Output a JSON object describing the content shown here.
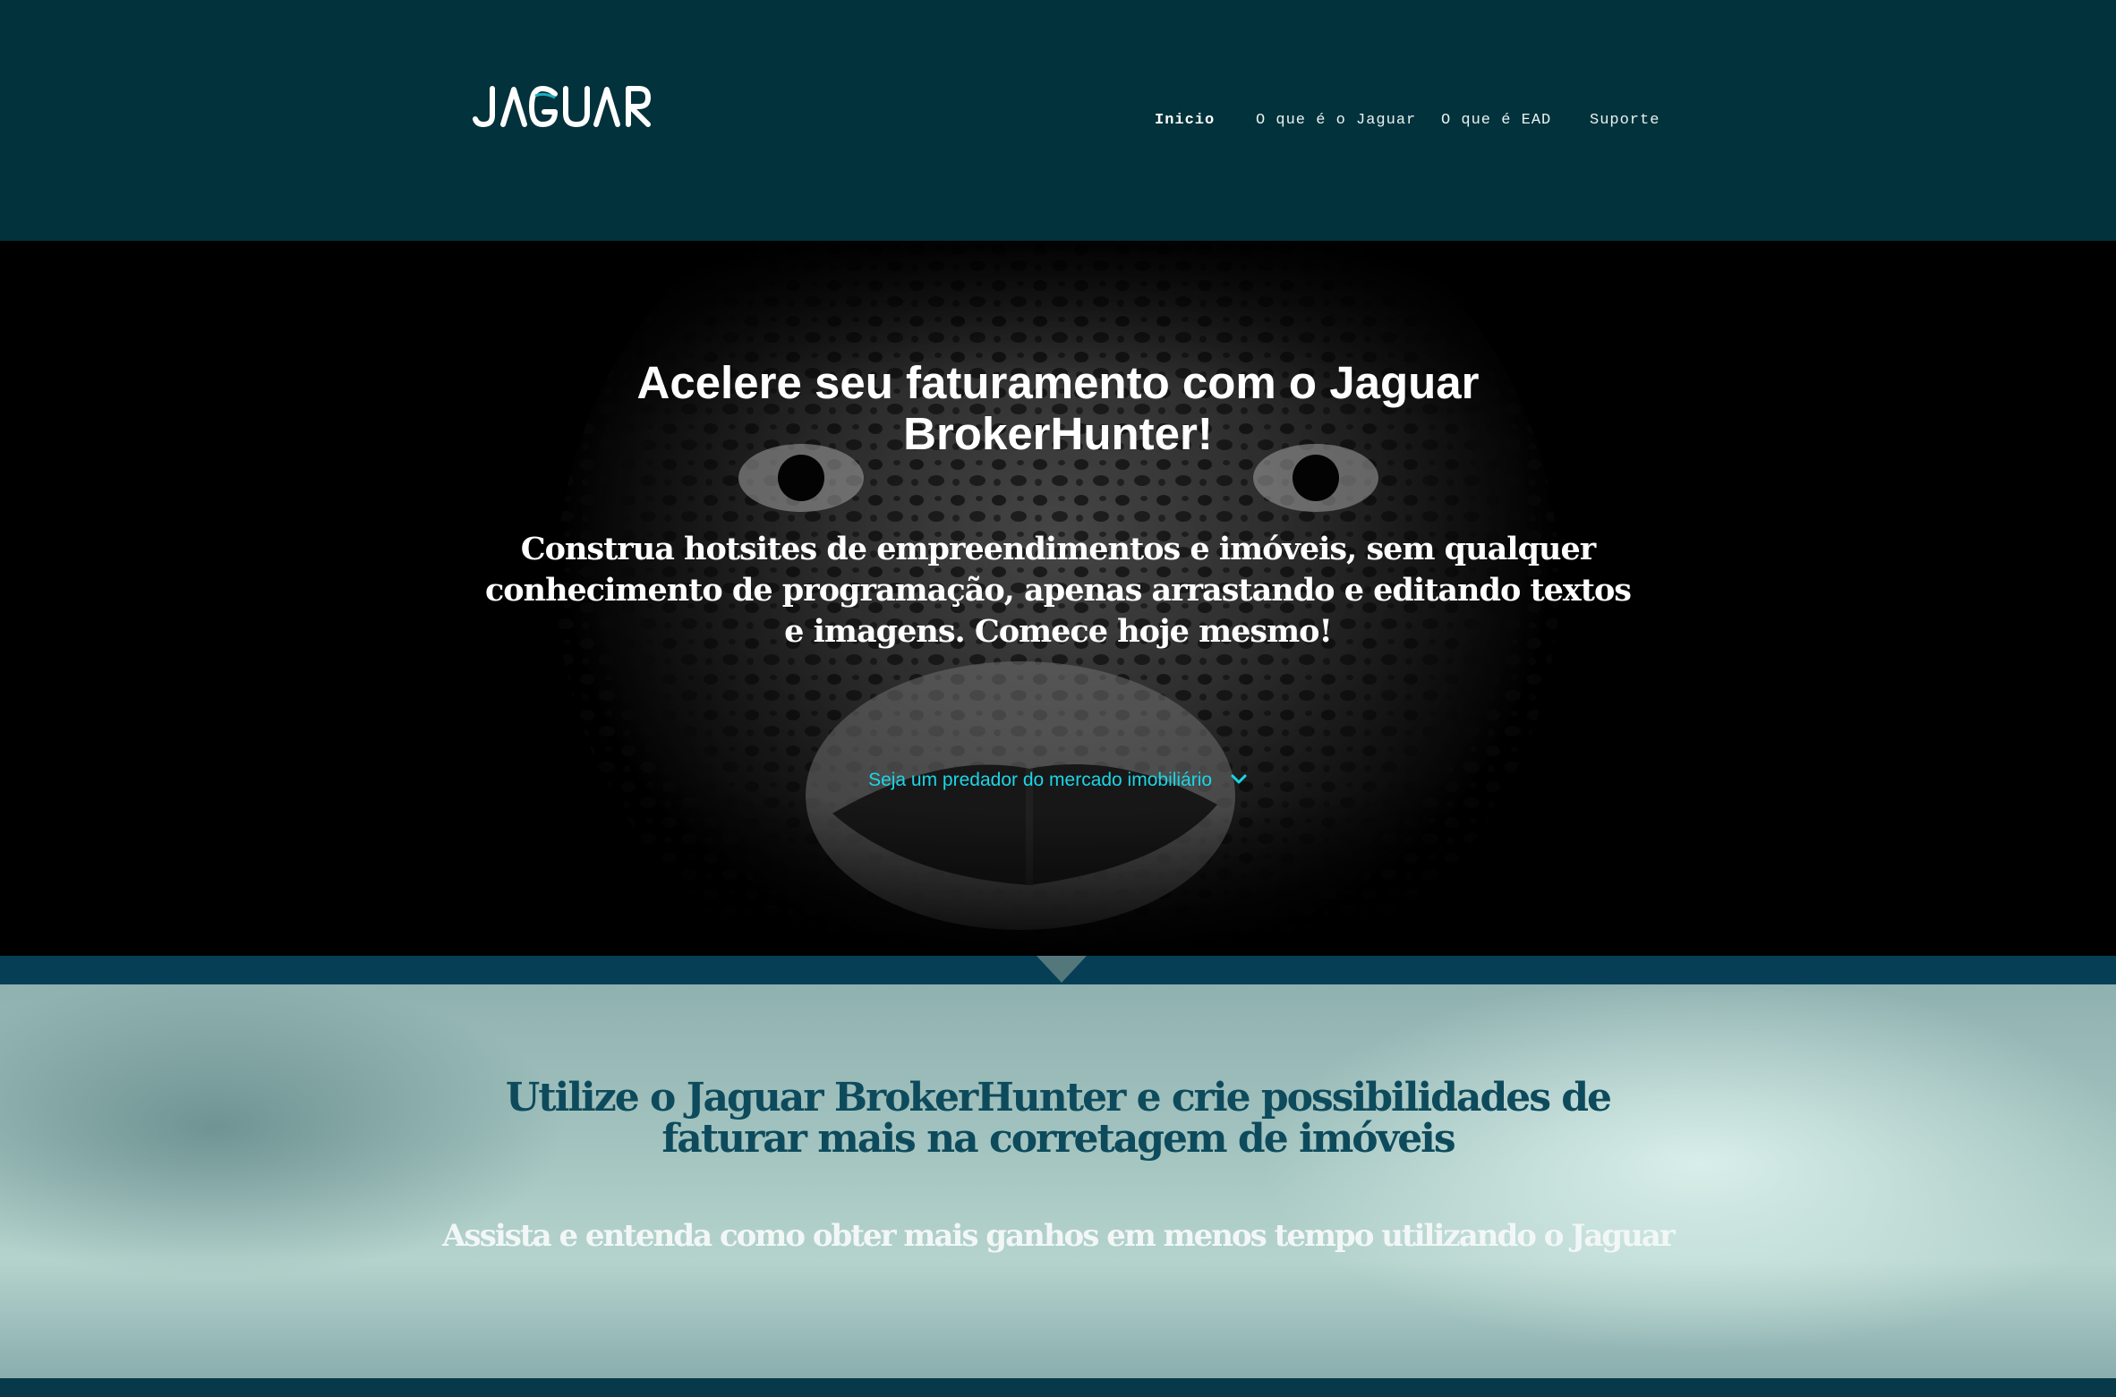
{
  "header": {
    "logo_text": "JAGUAR",
    "nav": [
      {
        "label": "Inicio",
        "active": true
      },
      {
        "label": "O que é o Jaguar",
        "active": false
      },
      {
        "label": "O que é EAD",
        "active": false
      },
      {
        "label": "Suporte",
        "active": false
      }
    ]
  },
  "hero": {
    "title_line1": "Acelere seu faturamento com o Jaguar",
    "title_line2": "BrokerHunter!",
    "subtitle": "Construa hotsites de empreendimentos e imóveis, sem qualquer conhecimento de programação, apenas arrastando e editando textos e imagens. Comece hoje mesmo!",
    "cta": "Seja um predador do mercado imobiliário",
    "cta_icon": "chevron-down-icon"
  },
  "section2": {
    "title": "Utilize o Jaguar BrokerHunter e crie possibilidades de faturar mais na corretagem de imóveis",
    "subtitle": "Assista e entenda como obter mais ganhos em menos tempo utilizando o Jaguar"
  },
  "colors": {
    "header_bg": "#02323b",
    "hero_bg": "#000000",
    "cta": "#1ad6e6",
    "band": "#063f55",
    "section2_title": "#0d4a5c"
  }
}
